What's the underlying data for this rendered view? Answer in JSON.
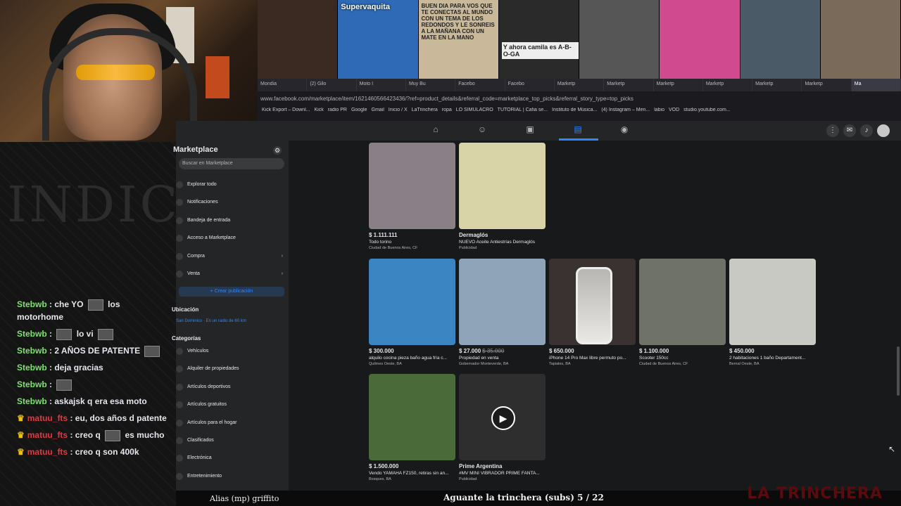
{
  "browser": {
    "thumbnails": [
      {
        "caption": "",
        "color": "#3b2a22"
      },
      {
        "caption": "Supervaquita",
        "color": "#2e6ab5"
      },
      {
        "caption": "BUEN DIA PARA VOS QUE TE CONECTAS AL MUNDO CON UN TEMA DE LOS REDONDOS Y LE SONREIS A LA MAÑANA CON UN MATE EN LA MANO",
        "color": "#c9b89a"
      },
      {
        "caption": "Y ahora camila es A-B-O-GA",
        "color": "#2a2a2a"
      },
      {
        "caption": "",
        "color": "#565656"
      },
      {
        "caption": "",
        "color": "#d04a8f"
      },
      {
        "caption": "",
        "color": "#4a5a66"
      },
      {
        "caption": "",
        "color": "#7a6a5a"
      }
    ],
    "tabs": [
      "Mondia",
      "(2) Gilo",
      "Moto I",
      "Muy Bu",
      "Facebo",
      "Facebo",
      "Marketp",
      "Marketp",
      "Marketp",
      "Marketp",
      "Marketp",
      "Marketp",
      "Ma"
    ],
    "url": "www.facebook.com/marketplace/item/1621460566423436/?ref=product_details&referral_code=marketplace_top_picks&referral_story_type=top_picks",
    "bookmarks": [
      "Kick Export – Downl...",
      "Kick",
      "radio PR",
      "Google",
      "Gmail",
      "Inicio / X",
      "LaTrinchera",
      "ropa",
      "LO SIMULACRO",
      "TUTORIAL | Cafia se...",
      "Instituto de Música...",
      "(4) Instagram – Men...",
      "labio",
      "VOD",
      "studio.youtube.com..."
    ]
  },
  "chat": {
    "messages": [
      {
        "user": "Stebwb",
        "mod": false,
        "text": "che YO",
        "emote": true,
        "after": "los motorhome"
      },
      {
        "user": "Stebwb",
        "mod": false,
        "text": "",
        "emote": true,
        "after": "lo vi"
      },
      {
        "user": "Stebwb",
        "mod": false,
        "text": "2 AÑOS DE PATENTE",
        "emote": true,
        "after": ""
      },
      {
        "user": "Stebwb",
        "mod": false,
        "text": "deja",
        "emote": false,
        "after": "gracias"
      },
      {
        "user": "Stebwb",
        "mod": false,
        "text": "",
        "emote": true,
        "after": ""
      },
      {
        "user": "Stebwb",
        "mod": false,
        "text": "askajsk q era esa moto",
        "emote": false,
        "after": ""
      },
      {
        "user": "matuu_fts",
        "mod": true,
        "text": "eu, dos años d patente",
        "emote": false,
        "after": ""
      },
      {
        "user": "matuu_fts",
        "mod": true,
        "text": "creo q",
        "emote": true,
        "after": "es mucho"
      },
      {
        "user": "matuu_fts",
        "mod": true,
        "text": "creo q son 400k",
        "emote": false,
        "after": ""
      }
    ]
  },
  "marketplace": {
    "title": "Marketplace",
    "search_placeholder": "Buscar en Marketplace",
    "nav": [
      "Explorar todo",
      "Notificaciones",
      "Bandeja de entrada",
      "Acceso a Marketplace",
      "Compra",
      "Venta"
    ],
    "create_label": "+ Crear publicación",
    "location_heading": "Ubicación",
    "location_value": "San Dominico · En un radio de 60 km",
    "categories_heading": "Categorías",
    "categories": [
      "Vehículos",
      "Alquiler de propiedades",
      "Artículos deportivos",
      "Artículos gratuitos",
      "Artículos para el hogar",
      "Clasificados",
      "Electrónica",
      "Entretenimiento"
    ]
  },
  "listings": [
    {
      "price": "$ 1.111.111",
      "old_price": "",
      "title": "Todo torino",
      "location": "Ciudad de Buenos Aires, CF",
      "color": "#8a7f86"
    },
    {
      "price": "Dermaglós",
      "old_price": "",
      "title": "NUEVO Aceite Antiestrías Dermaglós",
      "location": "Publicidad",
      "color": "#d9d4a8"
    },
    {
      "price": "$ 300.000",
      "old_price": "",
      "title": "alquilo cocina pieza baño agua fría c...",
      "location": "Quilmes Oeste, BA",
      "color": "#3b86c2"
    },
    {
      "price": "$ 27.000",
      "old_price": "$ 35.000",
      "title": "Propiedad en venta",
      "location": "Gobernador Monteverde, BA",
      "color": "#8fa4b8"
    },
    {
      "price": "$ 650.000",
      "old_price": "",
      "title": "iPhone 14 Pro Max libre permuto po...",
      "location": "Tapiales, BA",
      "color": "#3a3230"
    },
    {
      "price": "$ 1.100.000",
      "old_price": "",
      "title": "Scooter 150cc",
      "location": "Ciudad de Buenos Aires, CF",
      "color": "#6e7268"
    },
    {
      "price": "$ 450.000",
      "old_price": "",
      "title": "2 habitaciones 1 baño Departament...",
      "location": "Bernal Oeste, BA",
      "color": "#c9c9c4"
    },
    {
      "price": "$ 1.500.000",
      "old_price": "",
      "title": "Vendo YAMAHA FZ150, retiras sin an...",
      "location": "Bosques, BA",
      "color": "#4a6a3a"
    },
    {
      "price": "Prime Argentina",
      "old_price": "",
      "title": "#MV MINI VIBRADOR PRIME FANTA...",
      "location": "Publicidad",
      "color": "#2e2e2e"
    }
  ],
  "overlay": {
    "alias": "Alias (mp) griffito",
    "subs": "Aguante la trinchera (subs) 5 / 22",
    "brand": "LA TRINCHERA"
  }
}
